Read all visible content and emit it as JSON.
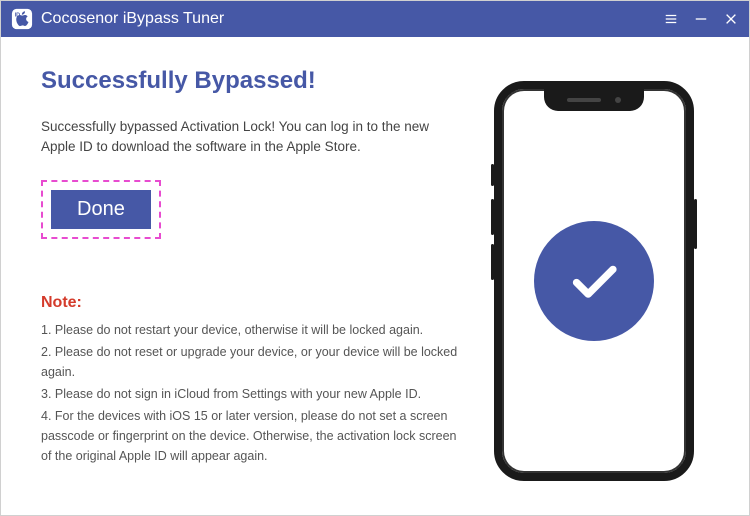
{
  "app": {
    "title": "Cocosenor iBypass Tuner"
  },
  "colors": {
    "accent": "#4658a6",
    "highlight_border": "#e84bd0",
    "note_title": "#d43b2b"
  },
  "main": {
    "heading": "Successfully Bypassed!",
    "description": "Successfully bypassed Activation Lock! You can log in to the new Apple ID to download the software in the Apple Store.",
    "done_label": "Done"
  },
  "note": {
    "title": "Note:",
    "items": [
      "1. Please do not restart your device, otherwise it will be locked again.",
      "2. Please do not reset or upgrade your device, or your device will be locked again.",
      "3. Please do not sign in iCloud from Settings with your new Apple ID.",
      "4. For the devices with iOS 15 or later version, please do not set a screen passcode or fingerprint on the device. Otherwise, the activation lock screen of the original Apple ID will appear again."
    ]
  }
}
